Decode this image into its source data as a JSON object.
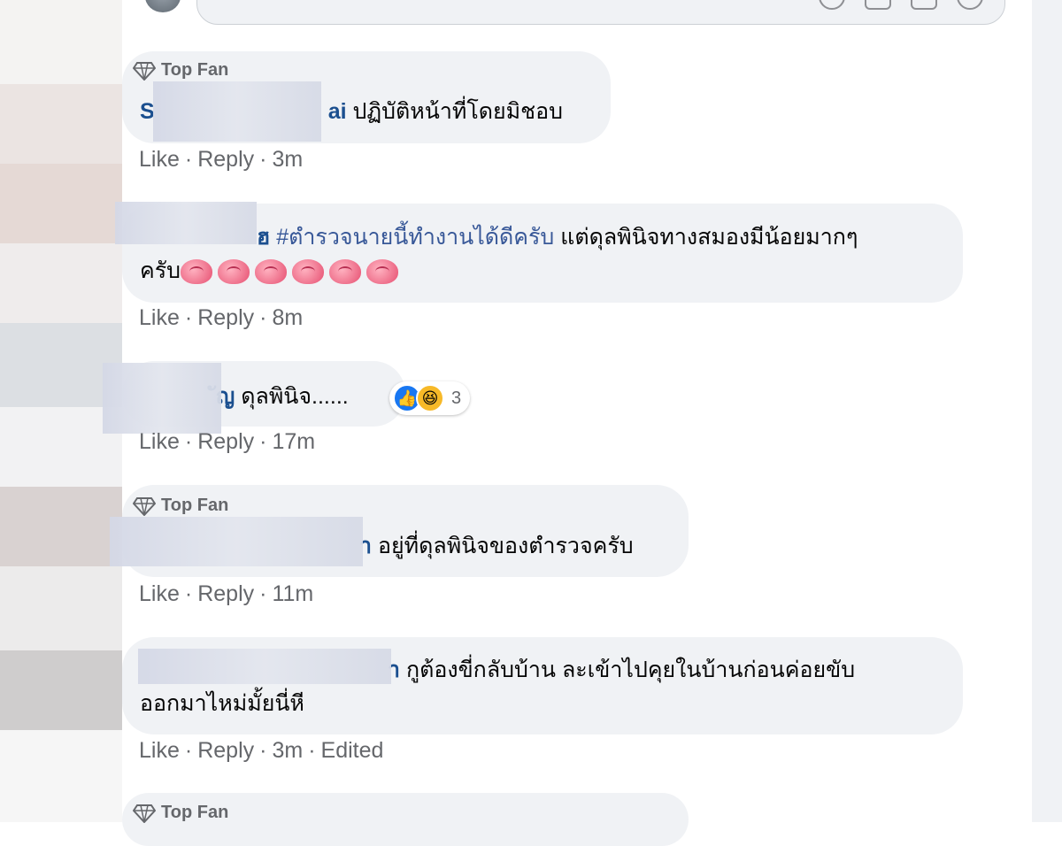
{
  "composer": {
    "icons": [
      "emoji-icon",
      "camera-icon",
      "gif-icon",
      "sticker-icon"
    ]
  },
  "comments": [
    {
      "badge": "Top Fan",
      "author_visible": "S",
      "author_tail": "ai",
      "text": "ปฏิบัติหน้าที่โดยมิชอบ",
      "actions": {
        "like": "Like",
        "reply": "Reply",
        "time": "3m"
      }
    },
    {
      "author_tail": "ฮ",
      "hashtag": "#ตำรวจนายนี้ทำงานได้ดีครับ",
      "text_line1": "แต่ดุลพินิจทางสมองมีน้อยมากๆ",
      "text_line2": "ครับ",
      "emoji": "brain",
      "emoji_count": 6,
      "actions": {
        "like": "Like",
        "reply": "Reply",
        "time": "8m"
      }
    },
    {
      "author_tail": "ัญ",
      "text": "ดุลพินิจ......",
      "reactions": {
        "types": [
          "like",
          "haha"
        ],
        "count": "3"
      },
      "actions": {
        "like": "Like",
        "reply": "Reply",
        "time": "17m"
      }
    },
    {
      "badge": "Top Fan",
      "author_tail": "า",
      "text": "อยู่ที่ดุลพินิจของตำรวจครับ",
      "actions": {
        "like": "Like",
        "reply": "Reply",
        "time": "11m"
      }
    },
    {
      "author_tail": "า",
      "text_line1": "กูต้องขี่กลับบ้าน ละเข้าไปคุยในบ้านก่อนค่อยขับ",
      "text_line2": "ออกมาไหม่มั้ยนี่หี",
      "actions": {
        "like": "Like",
        "reply": "Reply",
        "time": "3m",
        "edited": "Edited"
      }
    },
    {
      "badge": "Top Fan"
    }
  ],
  "colors": {
    "bubble": "#f0f2f5",
    "action_text": "#65676b",
    "link_blue": "#385898",
    "like_blue": "#1877f2",
    "haha_yellow": "#f7b928"
  }
}
